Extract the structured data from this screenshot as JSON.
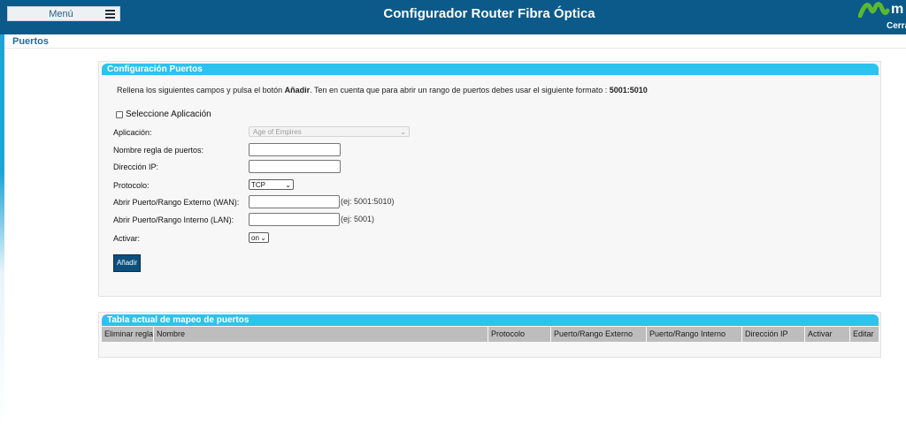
{
  "header": {
    "menu_label": "Menú",
    "title": "Configurador Router Fibra Óptica",
    "logo_text": "m",
    "logout_label": "Cerra"
  },
  "breadcrumb": "Puertos",
  "config_panel": {
    "title": "Configuración Puertos",
    "instructions_prefix": "Rellena los siguientes campos y pulsa el botón ",
    "instructions_bold": "Añadir",
    "instructions_middle": ". Ten en cuenta que para abrir un rango de puertos debes usar el siguiente formato : ",
    "instructions_format": "5001:5010",
    "select_app_label": "Seleccione Aplicación",
    "fields": {
      "application_label": "Aplicación:",
      "application_value": "Age of Empires",
      "rule_name_label": "Nombre regla de puertos:",
      "ip_label": "Dirección IP:",
      "protocol_label": "Protocolo:",
      "protocol_value": "TCP",
      "external_label": "Abrir Puerto/Rango Externo (WAN):",
      "external_hint": "(ej: 5001:5010)",
      "internal_label": "Abrir Puerto/Rango Interno (LAN):",
      "internal_hint": "(ej: 5001)",
      "activate_label": "Activar:",
      "activate_value": "on"
    },
    "add_button": "Añadir"
  },
  "table_panel": {
    "title": "Tabla actual de mapeo de puertos",
    "columns": [
      "Eliminar regla",
      "Nombre",
      "Protocolo",
      "Puerto/Rango Externo",
      "Puerto/Rango Interno",
      "Dirección IP",
      "Activar",
      "Editar"
    ]
  },
  "colors": {
    "header_bg": "#0b5a8a",
    "panel_header": "#2cc3ee",
    "button_bg": "#0b4f7d",
    "logo_green": "#5cb82e"
  }
}
